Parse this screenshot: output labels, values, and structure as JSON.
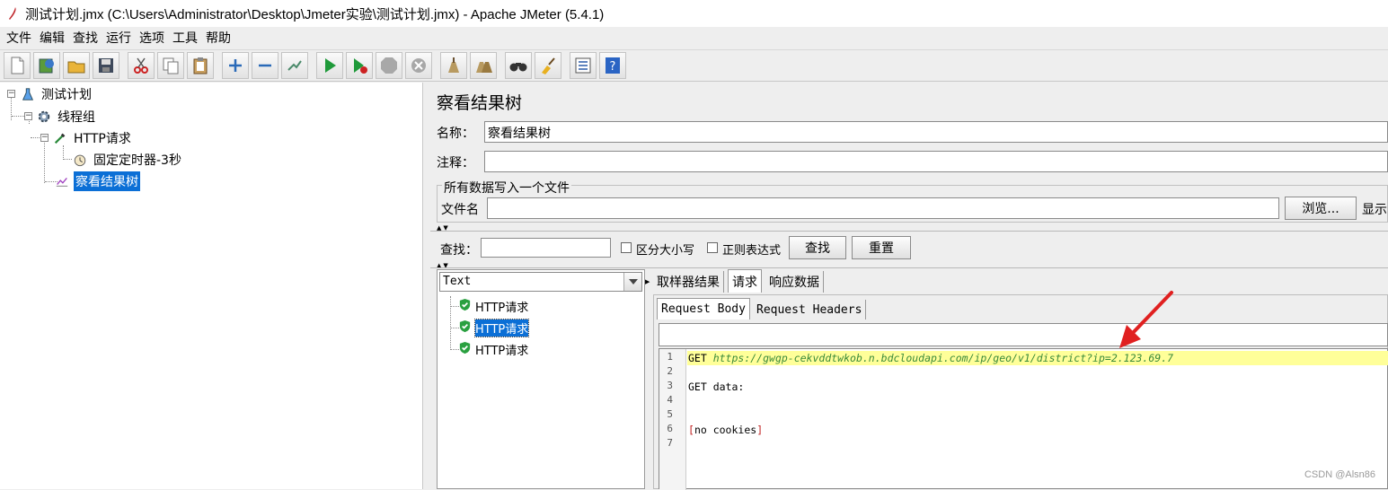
{
  "window": {
    "title": "测试计划.jmx (C:\\Users\\Administrator\\Desktop\\Jmeter实验\\测试计划.jmx) - Apache JMeter (5.4.1)"
  },
  "menu": [
    "文件",
    "编辑",
    "查找",
    "运行",
    "选项",
    "工具",
    "帮助"
  ],
  "toolbar": {
    "icons": [
      "new-icon",
      "templates-icon",
      "open-icon",
      "save-icon",
      "cut-icon",
      "copy-icon",
      "paste-icon",
      "expand-icon",
      "collapse-icon",
      "toggle-icon",
      "start-icon",
      "start-no-pause-icon",
      "stop-icon",
      "shutdown-icon",
      "clear-icon",
      "clear-all-icon",
      "search-icon",
      "reset-search-icon",
      "function-helper-icon",
      "help-icon"
    ]
  },
  "tree": {
    "root": "测试计划",
    "thread_group": "线程组",
    "http_request": "HTTP请求",
    "timer": "固定定时器-3秒",
    "listener": "察看结果树"
  },
  "panel": {
    "title": "察看结果树",
    "name_label": "名称：",
    "name_value": "察看结果树",
    "comment_label": "注释：",
    "comment_value": "",
    "file_group_title": "所有数据写入一个文件",
    "filename_label": "文件名",
    "filename_value": "",
    "browse_button": "浏览...",
    "display_label": "显示"
  },
  "search": {
    "label": "查找：",
    "value": "",
    "case_sensitive": "区分大小写",
    "regex": "正则表达式",
    "find_button": "查找",
    "reset_button": "重置"
  },
  "results": {
    "renderer": "Text",
    "items": [
      "HTTP请求",
      "HTTP请求",
      "HTTP请求"
    ],
    "selected_index": 1
  },
  "tabs": [
    "取样器结果",
    "请求",
    "响应数据"
  ],
  "active_tab": "请求",
  "subtabs": [
    "Request Body",
    "Request Headers"
  ],
  "editor": {
    "line_numbers": [
      "1",
      "2",
      "3",
      "4",
      "5",
      "6",
      "7"
    ],
    "line1_method": "GET ",
    "line1_url": "https://gwgp-cekvddtwkob.n.bdcloudapi.com/ip/geo/v1/district?ip=2.123.69.7",
    "line3": "GET data:",
    "line6_open": "[",
    "line6_text": "no cookies",
    "line6_close": "]"
  },
  "watermark": "CSDN @Alsn86",
  "colors": {
    "selection": "#0b6fd6",
    "highlight_line": "#ffff99",
    "url": "#3a8a3a",
    "arrow": "#e02020"
  }
}
